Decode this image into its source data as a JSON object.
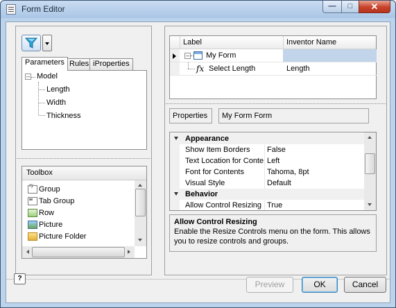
{
  "window": {
    "title": "Form Editor"
  },
  "left": {
    "tabs": [
      "Parameters",
      "Rules",
      "iProperties"
    ],
    "tree": {
      "root": "Model",
      "children": [
        "Length",
        "Width",
        "Thickness"
      ]
    },
    "toolbox": {
      "header": "Toolbox",
      "items": [
        "Group",
        "Tab Group",
        "Row",
        "Picture",
        "Picture Folder"
      ]
    }
  },
  "right": {
    "grid": {
      "columns": [
        "Label",
        "Inventor Name"
      ],
      "rows": [
        {
          "label": "My Form",
          "name": ""
        },
        {
          "label": "Select Length",
          "name": "Length"
        }
      ],
      "fx": "fx"
    },
    "properties": {
      "label": "Properties",
      "object_name": "My Form Form",
      "categories": [
        {
          "name": "Appearance",
          "rows": [
            {
              "name": "Show Item Borders",
              "value": "False"
            },
            {
              "name": "Text Location for Conte",
              "value": "Left"
            },
            {
              "name": "Font for Contents",
              "value": "Tahoma, 8pt"
            },
            {
              "name": "Visual Style",
              "value": "Default"
            }
          ]
        },
        {
          "name": "Behavior",
          "rows": [
            {
              "name": "Allow Control Resizing",
              "value": "True"
            }
          ]
        }
      ],
      "description": {
        "title": "Allow Control Resizing",
        "text": "Enable the Resize Controls menu on the form.  This allows you to resize controls and groups."
      }
    }
  },
  "footer": {
    "help": "?",
    "preview": "Preview",
    "ok": "OK",
    "cancel": "Cancel"
  },
  "colors": {
    "titlebar": "#bcd3ec",
    "selection": "#c2d4ea",
    "close": "#c7432a"
  }
}
